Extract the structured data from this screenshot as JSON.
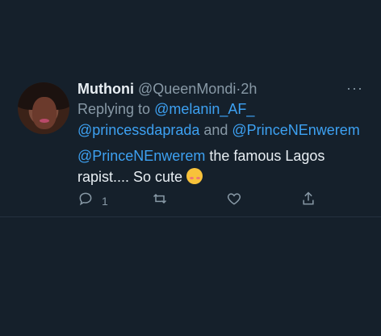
{
  "tweet": {
    "name": "Muthoni",
    "handle": "@QueenMondi",
    "separator": "·",
    "time": "2h",
    "reply_prefix": "Replying to ",
    "reply_mention_1": "@melanin_AF_",
    "reply_mention_2": "@princessdaprada",
    "reply_and": " and ",
    "reply_mention_3": "@PrinceNEnwerem",
    "text_mention": "@PrinceNEnwerem",
    "text_body": " the famous Lagos rapist.... So cute ",
    "more_label": "···"
  },
  "actions": {
    "reply_count": "1",
    "reply_icon": "reply-icon",
    "retweet_icon": "retweet-icon",
    "like_icon": "heart-icon",
    "share_icon": "share-icon"
  },
  "colors": {
    "background": "#15202b",
    "accent": "#3da1f2",
    "muted": "#8899a6"
  }
}
